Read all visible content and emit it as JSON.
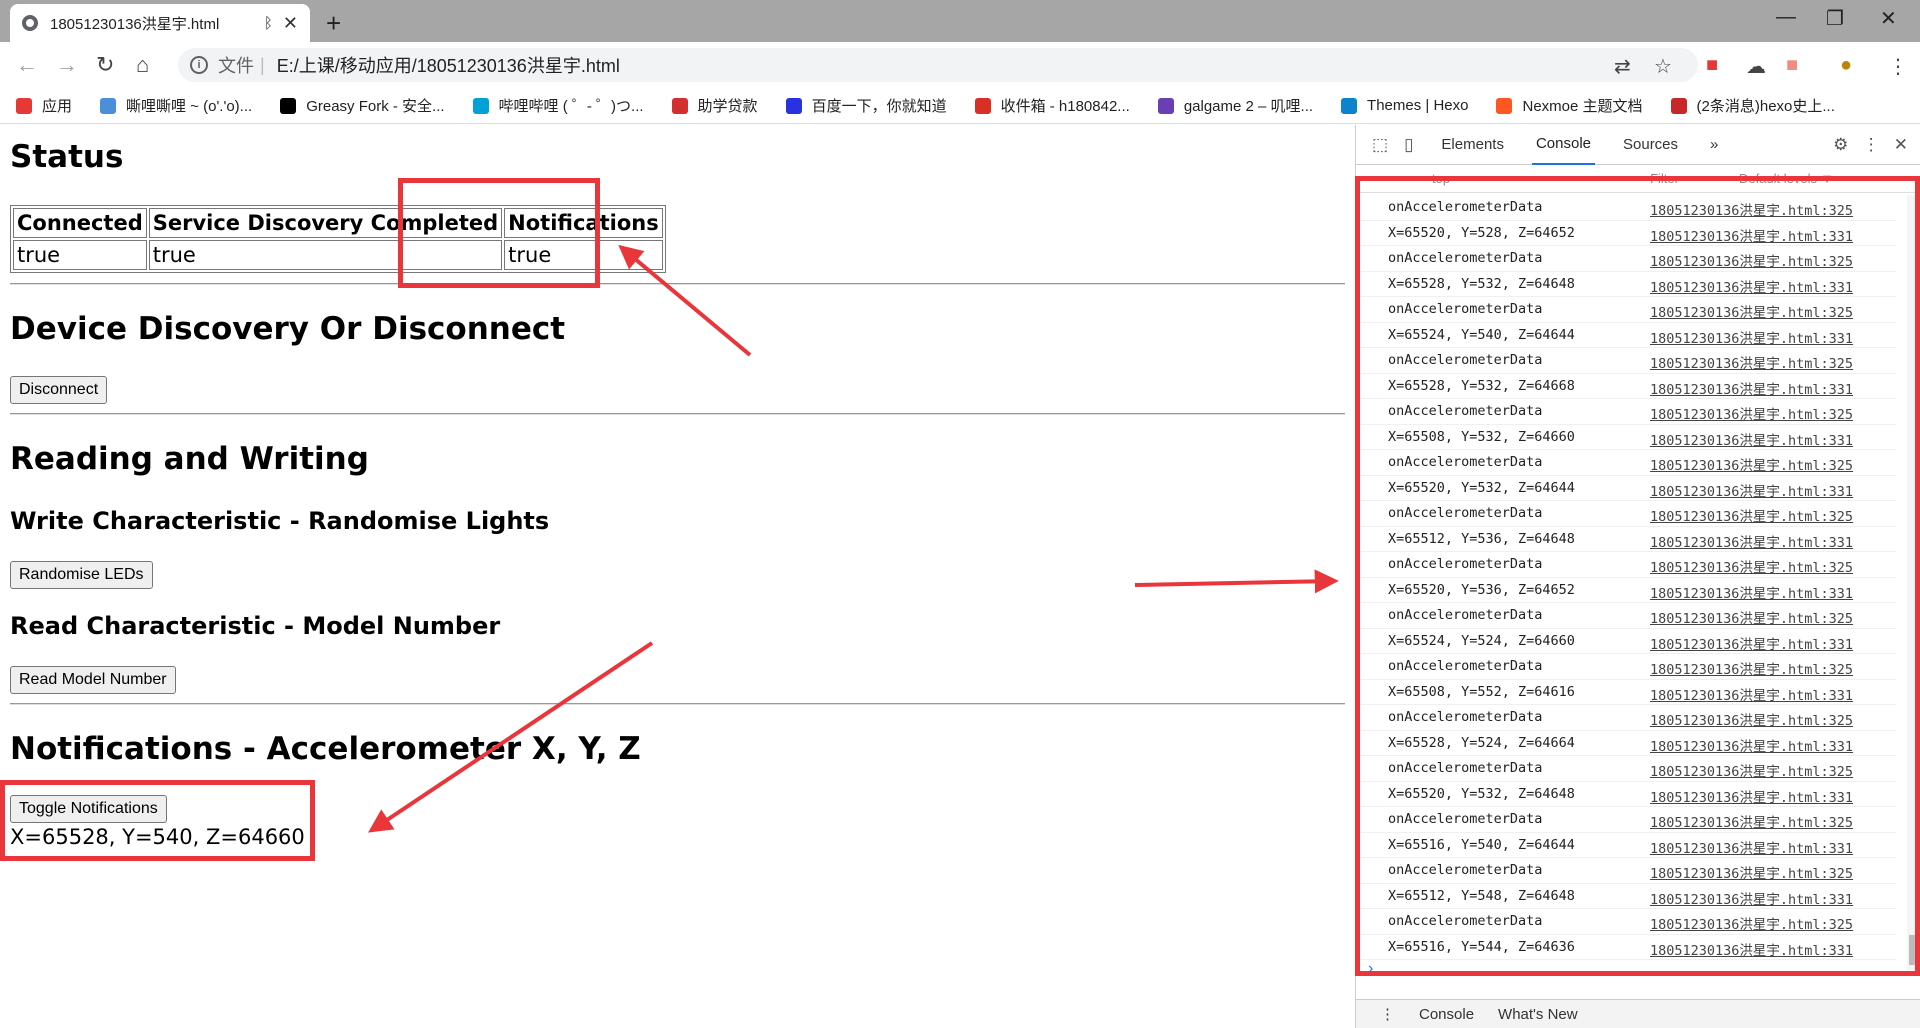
{
  "browser": {
    "tab_title": "18051230136洪星宇.html",
    "tab_bluetooth_icon": "ᛒ",
    "tab_close": "✕",
    "new_tab": "+",
    "scheme_label": "文件",
    "separator": "|",
    "url": "E:/上课/移动应用/18051230136洪星宇.html"
  },
  "bookmarks": [
    {
      "label": "应用",
      "color": "#e53935"
    },
    {
      "label": "嘶哩嘶哩 ~ (o'.'o)...",
      "color": "#4a90d9"
    },
    {
      "label": "Greasy Fork - 安全...",
      "color": "#000000"
    },
    {
      "label": "哔哩哔哩 ( ゜- ゜)つ...",
      "color": "#00a1d6"
    },
    {
      "label": "助学贷款",
      "color": "#d32f2f"
    },
    {
      "label": "百度一下，你就知道",
      "color": "#2932e1"
    },
    {
      "label": "收件箱 - h180842...",
      "color": "#d93025"
    },
    {
      "label": "galgame 2 – 叽哩...",
      "color": "#6a3fb5"
    },
    {
      "label": "Themes | Hexo",
      "color": "#0e83cd"
    },
    {
      "label": "Nexmoe 主题文档",
      "color": "#ff5722"
    },
    {
      "label": "(2条消息)hexo史上...",
      "color": "#c62828"
    }
  ],
  "page": {
    "status_heading": "Status",
    "table_headers": [
      "Connected",
      "Service Discovery Completed",
      "Notifications"
    ],
    "table_values": [
      "true",
      "true",
      "true"
    ],
    "discovery_heading": "Device Discovery Or Disconnect",
    "disconnect_label": "Disconnect",
    "rw_heading": "Reading and Writing",
    "write_heading": "Write Characteristic - Randomise Lights",
    "randomise_label": "Randomise LEDs",
    "read_heading": "Read Characteristic - Model Number",
    "read_label": "Read Model Number",
    "notif_heading": "Notifications - Accelerometer X, Y, Z",
    "toggle_label": "Toggle Notifications",
    "accel_readout": "X=65528, Y=540, Z=64660"
  },
  "devtools": {
    "tabs": [
      "Elements",
      "Console",
      "Sources"
    ],
    "active_tab": "Console",
    "more": "»",
    "filter_context": "top",
    "filter_placeholder": "Filter",
    "levels": "Default levels ▼",
    "drawer_tabs": [
      "Console",
      "What's New"
    ],
    "prompt": "›",
    "console_rows": [
      {
        "msg": "onAccelerometerData",
        "src": "18051230136洪星宇.html:325"
      },
      {
        "msg": "X=65520, Y=528, Z=64652",
        "src": "18051230136洪星宇.html:331"
      },
      {
        "msg": "onAccelerometerData",
        "src": "18051230136洪星宇.html:325"
      },
      {
        "msg": "X=65528, Y=532, Z=64648",
        "src": "18051230136洪星宇.html:331"
      },
      {
        "msg": "onAccelerometerData",
        "src": "18051230136洪星宇.html:325"
      },
      {
        "msg": "X=65524, Y=540, Z=64644",
        "src": "18051230136洪星宇.html:331"
      },
      {
        "msg": "onAccelerometerData",
        "src": "18051230136洪星宇.html:325"
      },
      {
        "msg": "X=65528, Y=532, Z=64668",
        "src": "18051230136洪星宇.html:331"
      },
      {
        "msg": "onAccelerometerData",
        "src": "18051230136洪星宇.html:325"
      },
      {
        "msg": "X=65508, Y=532, Z=64660",
        "src": "18051230136洪星宇.html:331"
      },
      {
        "msg": "onAccelerometerData",
        "src": "18051230136洪星宇.html:325"
      },
      {
        "msg": "X=65520, Y=532, Z=64644",
        "src": "18051230136洪星宇.html:331"
      },
      {
        "msg": "onAccelerometerData",
        "src": "18051230136洪星宇.html:325"
      },
      {
        "msg": "X=65512, Y=536, Z=64648",
        "src": "18051230136洪星宇.html:331"
      },
      {
        "msg": "onAccelerometerData",
        "src": "18051230136洪星宇.html:325"
      },
      {
        "msg": "X=65520, Y=536, Z=64652",
        "src": "18051230136洪星宇.html:331"
      },
      {
        "msg": "onAccelerometerData",
        "src": "18051230136洪星宇.html:325"
      },
      {
        "msg": "X=65524, Y=524, Z=64660",
        "src": "18051230136洪星宇.html:331"
      },
      {
        "msg": "onAccelerometerData",
        "src": "18051230136洪星宇.html:325"
      },
      {
        "msg": "X=65508, Y=552, Z=64616",
        "src": "18051230136洪星宇.html:331"
      },
      {
        "msg": "onAccelerometerData",
        "src": "18051230136洪星宇.html:325"
      },
      {
        "msg": "X=65528, Y=524, Z=64664",
        "src": "18051230136洪星宇.html:331"
      },
      {
        "msg": "onAccelerometerData",
        "src": "18051230136洪星宇.html:325"
      },
      {
        "msg": "X=65520, Y=532, Z=64648",
        "src": "18051230136洪星宇.html:331"
      },
      {
        "msg": "onAccelerometerData",
        "src": "18051230136洪星宇.html:325"
      },
      {
        "msg": "X=65516, Y=540, Z=64644",
        "src": "18051230136洪星宇.html:331"
      },
      {
        "msg": "onAccelerometerData",
        "src": "18051230136洪星宇.html:325"
      },
      {
        "msg": "X=65512, Y=548, Z=64648",
        "src": "18051230136洪星宇.html:331"
      },
      {
        "msg": "onAccelerometerData",
        "src": "18051230136洪星宇.html:325"
      },
      {
        "msg": "X=65516, Y=544, Z=64636",
        "src": "18051230136洪星宇.html:331"
      }
    ]
  },
  "annotation_color": "#e8363b"
}
